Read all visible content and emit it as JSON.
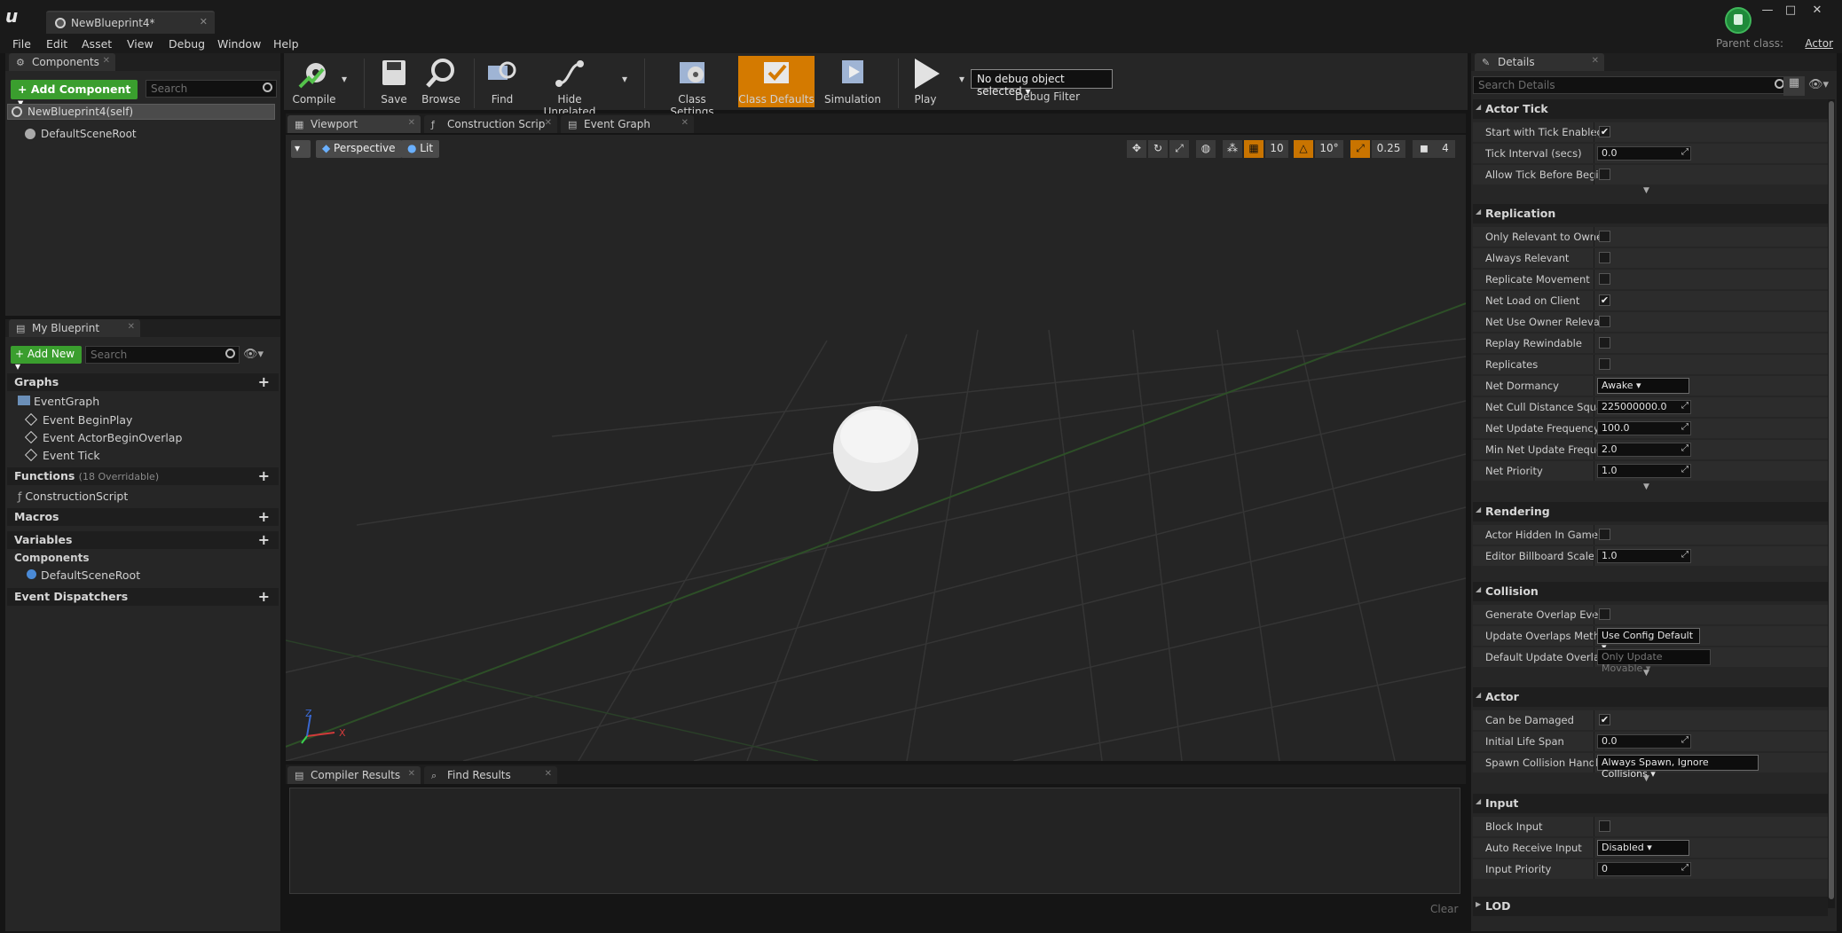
{
  "window": {
    "doc_tab": "NewBlueprint4*",
    "parent_class_label": "Parent class:",
    "parent_class": "Actor",
    "min": "—",
    "max": "□",
    "close": "✕"
  },
  "menu": [
    "File",
    "Edit",
    "Asset",
    "View",
    "Debug",
    "Window",
    "Help"
  ],
  "components": {
    "tab": "Components",
    "add_button": "+ Add Component ▾",
    "search_placeholder": "Search",
    "self_row": "NewBlueprint4(self)",
    "root": "DefaultSceneRoot"
  },
  "my_blueprint": {
    "tab": "My Blueprint",
    "add_new": "+ Add New ▾",
    "search_placeholder": "Search",
    "sections": {
      "graphs": "Graphs",
      "functions": "Functions",
      "functions_count": "(18 Overridable)",
      "macros": "Macros",
      "variables": "Variables",
      "components": "Components",
      "dispatchers": "Event Dispatchers"
    },
    "graph_items": [
      "EventGraph",
      "Event BeginPlay",
      "Event ActorBeginOverlap",
      "Event Tick"
    ],
    "function_items": [
      "ConstructionScript"
    ],
    "component_vars": [
      "DefaultSceneRoot"
    ]
  },
  "toolbar": {
    "compile": "Compile",
    "save": "Save",
    "browse": "Browse",
    "find": "Find",
    "hide_unrelated": "Hide Unrelated",
    "class_settings": "Class Settings",
    "class_defaults": "Class Defaults",
    "simulation": "Simulation",
    "play": "Play",
    "debug_object": "No debug object selected ▾",
    "debug_filter": "Debug Filter"
  },
  "editor_tabs": [
    "Viewport",
    "Construction Scrip",
    "Event Graph"
  ],
  "viewport": {
    "perspective": "Perspective",
    "lit": "Lit",
    "grid_snap": "10",
    "rot_snap": "10°",
    "scale_snap": "0.25",
    "cam_speed": "4",
    "axis_x": "X",
    "axis_z": "Z"
  },
  "results": {
    "tabs": [
      "Compiler Results",
      "Find Results"
    ],
    "clear": "Clear"
  },
  "details": {
    "tab": "Details",
    "search_placeholder": "Search Details",
    "categories": {
      "actor_tick": {
        "title": "Actor Tick",
        "props": [
          {
            "label": "Start with Tick Enabled",
            "type": "check",
            "value": "✔"
          },
          {
            "label": "Tick Interval (secs)",
            "type": "num",
            "value": "0.0"
          },
          {
            "label": "Allow Tick Before Begin",
            "type": "check",
            "value": ""
          }
        ]
      },
      "replication": {
        "title": "Replication",
        "props": [
          {
            "label": "Only Relevant to Owner",
            "type": "check",
            "value": ""
          },
          {
            "label": "Always Relevant",
            "type": "check",
            "value": ""
          },
          {
            "label": "Replicate Movement",
            "type": "check",
            "value": ""
          },
          {
            "label": "Net Load on Client",
            "type": "check",
            "value": "✔"
          },
          {
            "label": "Net Use Owner Relevanc",
            "type": "check",
            "value": ""
          },
          {
            "label": "Replay Rewindable",
            "type": "check",
            "value": ""
          },
          {
            "label": "Replicates",
            "type": "check",
            "value": ""
          },
          {
            "label": "Net Dormancy",
            "type": "combo",
            "value": "Awake"
          },
          {
            "label": "Net Cull Distance Square",
            "type": "num",
            "value": "225000000.0"
          },
          {
            "label": "Net Update Frequency",
            "type": "num",
            "value": "100.0"
          },
          {
            "label": "Min Net Update Frequen",
            "type": "num",
            "value": "2.0"
          },
          {
            "label": "Net Priority",
            "type": "num",
            "value": "1.0"
          }
        ]
      },
      "rendering": {
        "title": "Rendering",
        "props": [
          {
            "label": "Actor Hidden In Game",
            "type": "check",
            "value": ""
          },
          {
            "label": "Editor Billboard Scale",
            "type": "num",
            "value": "1.0"
          }
        ]
      },
      "collision": {
        "title": "Collision",
        "props": [
          {
            "label": "Generate Overlap Events",
            "type": "check",
            "value": ""
          },
          {
            "label": "Update Overlaps Method",
            "type": "combo",
            "value": "Use Config Default"
          },
          {
            "label": "Default Update Overlaps",
            "type": "combo-dis",
            "value": "Only Update Movable"
          }
        ]
      },
      "actor": {
        "title": "Actor",
        "props": [
          {
            "label": "Can be Damaged",
            "type": "check",
            "value": "✔"
          },
          {
            "label": "Initial Life Span",
            "type": "num",
            "value": "0.0"
          },
          {
            "label": "Spawn Collision Handlin",
            "type": "combo",
            "value": "Always Spawn, Ignore Collisions"
          }
        ]
      },
      "input": {
        "title": "Input",
        "props": [
          {
            "label": "Block Input",
            "type": "check",
            "value": ""
          },
          {
            "label": "Auto Receive Input",
            "type": "combo",
            "value": "Disabled"
          },
          {
            "label": "Input Priority",
            "type": "num",
            "value": "0"
          }
        ]
      },
      "lod": {
        "title": "LOD"
      }
    }
  },
  "colors": {
    "accent": "#d47a00",
    "green": "#3a9e2e",
    "panel": "#262626"
  }
}
